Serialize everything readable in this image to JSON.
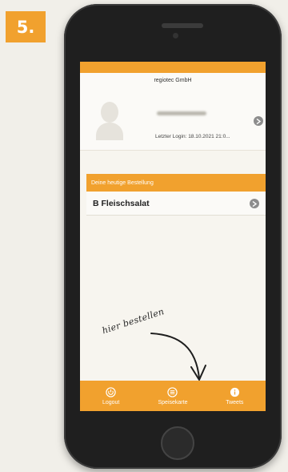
{
  "step": {
    "label": "5."
  },
  "app": {
    "company": "regiotec GmbH",
    "profile": {
      "last_login": "Letzter Login: 18.10.2021 21:0..."
    },
    "order": {
      "header": "Deine heutige Bestellung",
      "item": "B Fleischsalat"
    },
    "annotation": "hier bestellen",
    "tabs": [
      {
        "label": "Logout",
        "icon": "power-icon"
      },
      {
        "label": "Speisekarte",
        "icon": "menu-list-icon"
      },
      {
        "label": "Tweets",
        "icon": "info-icon"
      }
    ]
  },
  "colors": {
    "accent": "#f1a12e",
    "phone_body": "#1f1f1f",
    "screen_bg": "#f7f5ef"
  }
}
